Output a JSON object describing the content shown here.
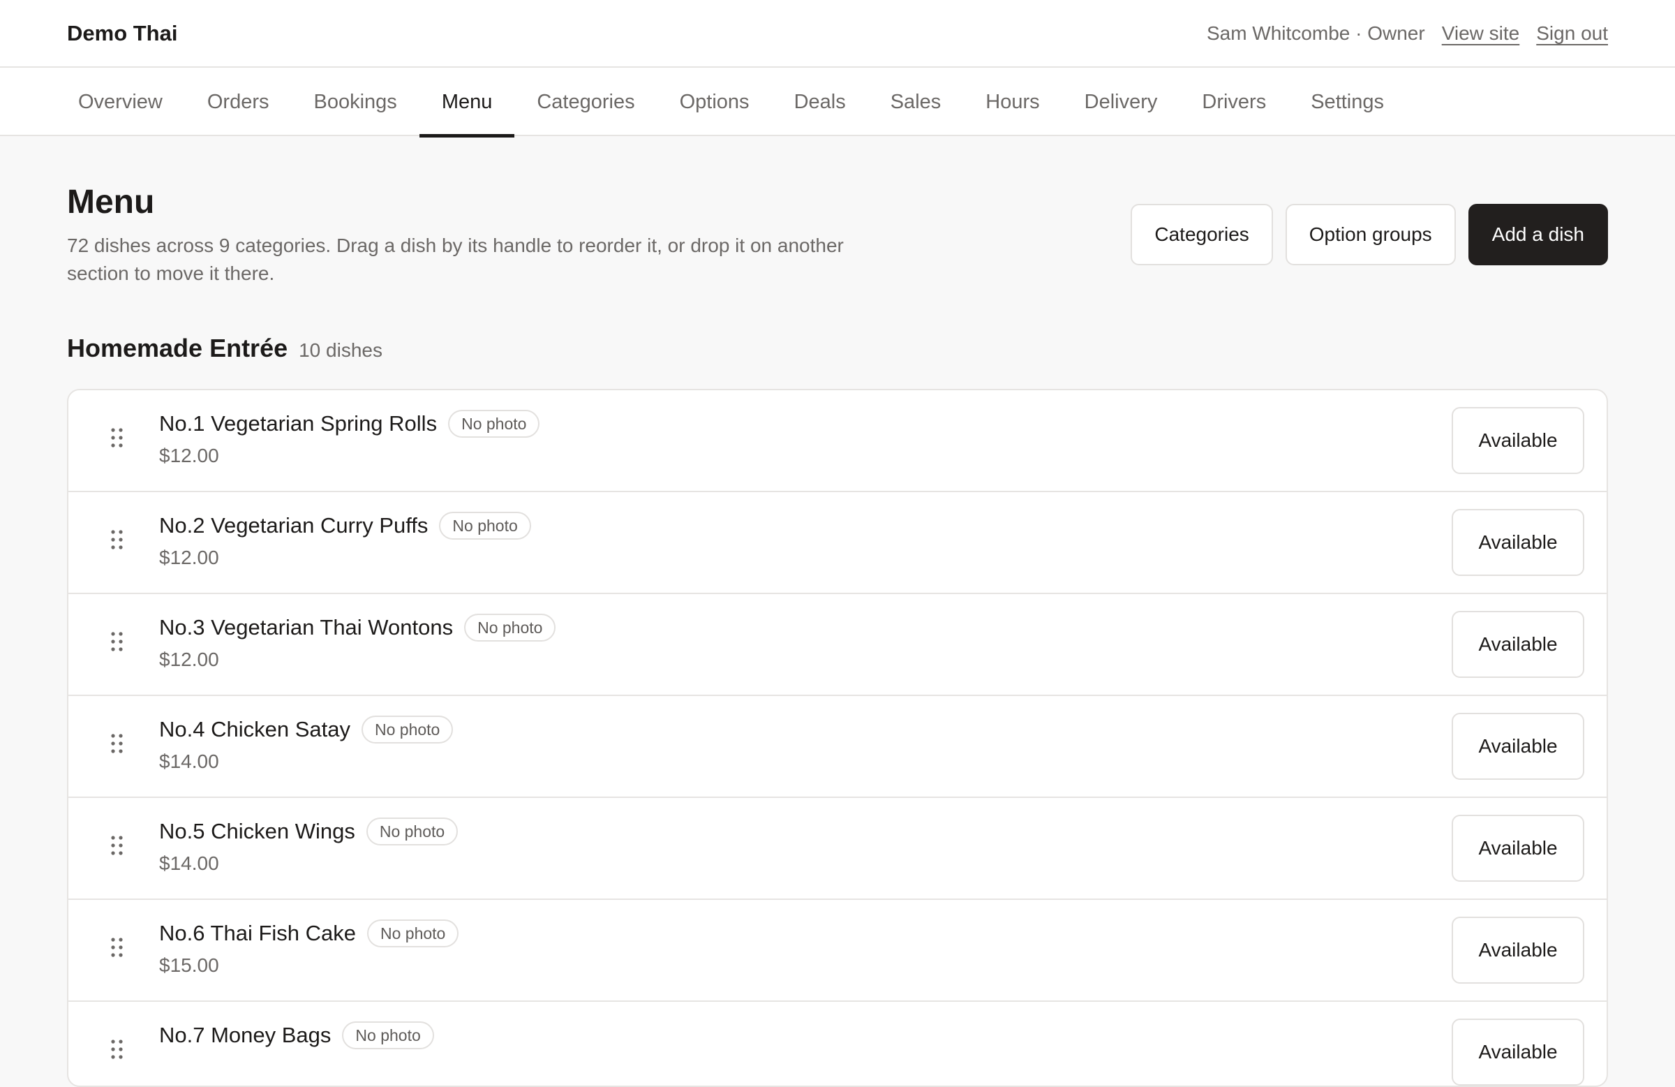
{
  "app": {
    "brand": "Demo Thai",
    "user_label": "Sam Whitcombe · Owner",
    "view_site_label": "View site",
    "sign_out_label": "Sign out"
  },
  "tabs": [
    {
      "label": "Overview",
      "active": false
    },
    {
      "label": "Orders",
      "active": false
    },
    {
      "label": "Bookings",
      "active": false
    },
    {
      "label": "Menu",
      "active": true
    },
    {
      "label": "Categories",
      "active": false
    },
    {
      "label": "Options",
      "active": false
    },
    {
      "label": "Deals",
      "active": false
    },
    {
      "label": "Sales",
      "active": false
    },
    {
      "label": "Hours",
      "active": false
    },
    {
      "label": "Delivery",
      "active": false
    },
    {
      "label": "Drivers",
      "active": false
    },
    {
      "label": "Settings",
      "active": false
    }
  ],
  "page": {
    "title": "Menu",
    "description": "72 dishes across 9 categories. Drag a dish by its handle to reorder it, or drop it on another section to move it there.",
    "actions": {
      "categories_label": "Categories",
      "option_groups_label": "Option groups",
      "add_dish_label": "Add a dish"
    }
  },
  "section": {
    "title": "Homemade Entrée",
    "count": "10 dishes",
    "dishes": [
      {
        "name": "No.1 Vegetarian Spring Rolls",
        "badge": "No photo",
        "price": "$12.00",
        "status": "Available"
      },
      {
        "name": "No.2 Vegetarian Curry Puffs",
        "badge": "No photo",
        "price": "$12.00",
        "status": "Available"
      },
      {
        "name": "No.3 Vegetarian Thai Wontons",
        "badge": "No photo",
        "price": "$12.00",
        "status": "Available"
      },
      {
        "name": "No.4 Chicken Satay",
        "badge": "No photo",
        "price": "$14.00",
        "status": "Available"
      },
      {
        "name": "No.5 Chicken Wings",
        "badge": "No photo",
        "price": "$14.00",
        "status": "Available"
      },
      {
        "name": "No.6 Thai Fish Cake",
        "badge": "No photo",
        "price": "$15.00",
        "status": "Available"
      },
      {
        "name": "No.7 Money Bags",
        "badge": "No photo",
        "price": "",
        "status": "Available"
      }
    ]
  },
  "icons": {
    "drag_handle": "grip-dots-icon"
  }
}
